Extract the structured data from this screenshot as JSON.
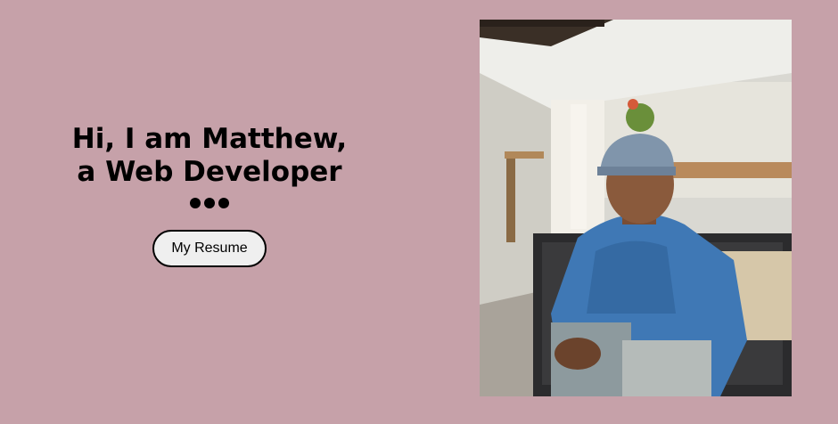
{
  "hero": {
    "line1": "Hi, I am Matthew,",
    "line2": "a Web Developer",
    "resume_button": "My Resume"
  },
  "colors": {
    "background": "#c6a1a9",
    "text": "#000000",
    "button_bg": "#efefef"
  },
  "profile_photo": {
    "subject": "young man in blue sweater and grey cap sitting on a woven chair"
  }
}
